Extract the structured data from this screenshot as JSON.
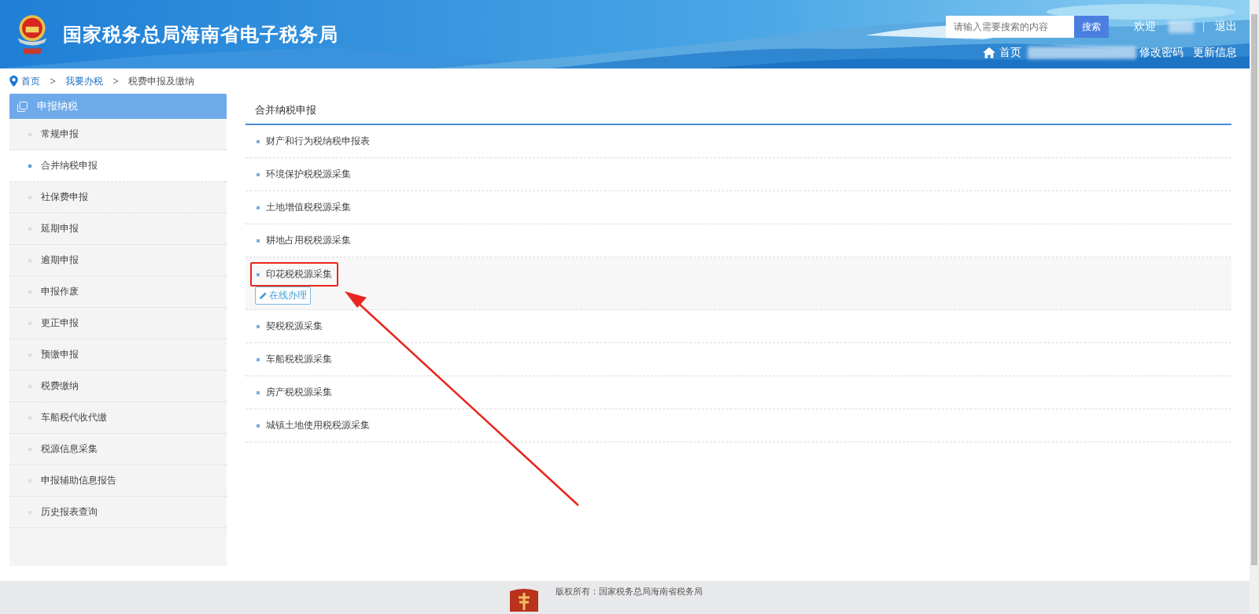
{
  "header": {
    "title": "国家税务总局海南省电子税务局",
    "search": {
      "placeholder": "请输入需要搜索的内容",
      "button": "搜索"
    },
    "welcome": "欢迎",
    "logout": "退出",
    "home": "首页",
    "change_password": "修改密码",
    "update_info": "更新信息"
  },
  "breadcrumb": [
    "首页",
    "我要办税",
    "税费申报及缴纳"
  ],
  "sidebar": {
    "title": "申报纳税",
    "items": [
      {
        "label": "常规申报",
        "selected": false
      },
      {
        "label": "合并纳税申报",
        "selected": true
      },
      {
        "label": "社保费申报",
        "selected": false
      },
      {
        "label": "延期申报",
        "selected": false
      },
      {
        "label": "逾期申报",
        "selected": false
      },
      {
        "label": "申报作废",
        "selected": false
      },
      {
        "label": "更正申报",
        "selected": false
      },
      {
        "label": "预缴申报",
        "selected": false
      },
      {
        "label": "税费缴纳",
        "selected": false
      },
      {
        "label": "车船税代收代缴",
        "selected": false
      },
      {
        "label": "税源信息采集",
        "selected": false
      },
      {
        "label": "申报辅助信息报告",
        "selected": false
      },
      {
        "label": "历史报表查询",
        "selected": false
      }
    ]
  },
  "main": {
    "title": "合并纳税申报",
    "items": [
      {
        "label": "财产和行为税纳税申报表",
        "expanded": false
      },
      {
        "label": "环境保护税税源采集",
        "expanded": false
      },
      {
        "label": "土地增值税税源采集",
        "expanded": false
      },
      {
        "label": "耕地占用税税源采集",
        "expanded": false
      },
      {
        "label": "印花税税源采集",
        "expanded": true,
        "action": "在线办理",
        "annotated": true
      },
      {
        "label": "契税税源采集",
        "expanded": false
      },
      {
        "label": "车船税税源采集",
        "expanded": false
      },
      {
        "label": "房产税税源采集",
        "expanded": false
      },
      {
        "label": "城镇土地使用税税源采集",
        "expanded": false
      }
    ]
  },
  "footer": {
    "copyright": "版权所有：国家税务总局海南省税务局"
  }
}
